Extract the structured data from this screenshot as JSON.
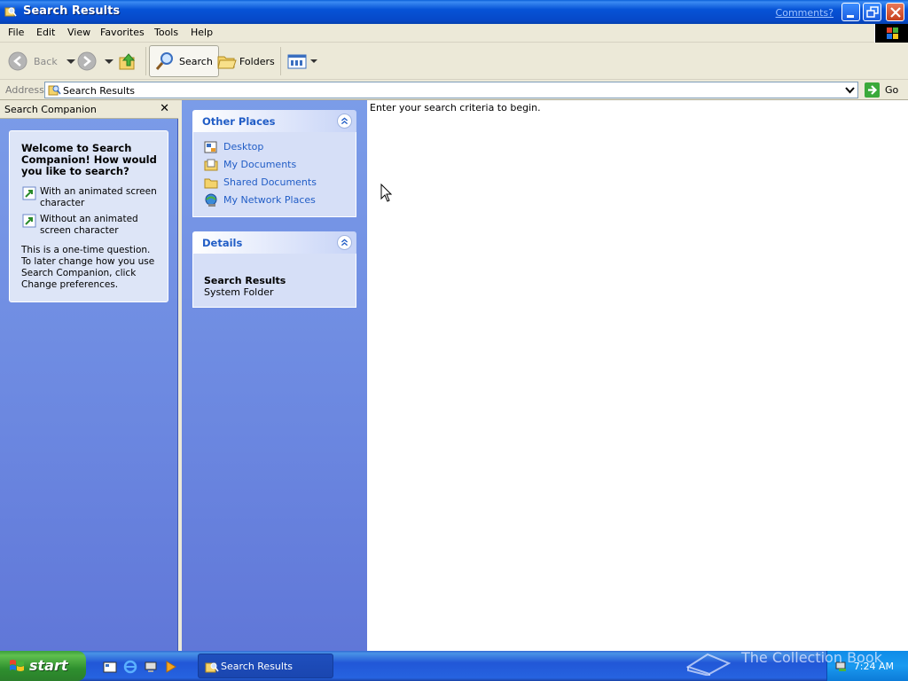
{
  "window": {
    "title": "Search Results",
    "comments_link": "Comments?"
  },
  "menu": [
    "File",
    "Edit",
    "View",
    "Favorites",
    "Tools",
    "Help"
  ],
  "toolbar": {
    "back_label": "Back",
    "search_label": "Search",
    "folders_label": "Folders"
  },
  "address": {
    "label": "Address",
    "value": "Search Results",
    "go_label": "Go"
  },
  "companion": {
    "title": "Search Companion",
    "welcome_title": "Welcome to Search Companion! How would you like to search?",
    "options": [
      "With an animated screen character",
      "Without an animated screen character"
    ],
    "note": "This is a one-time question. To later change how you use Search Companion, click Change preferences."
  },
  "tasks": {
    "other_places": {
      "title": "Other Places",
      "links": [
        "Desktop",
        "My Documents",
        "Shared Documents",
        "My Network Places"
      ]
    },
    "details": {
      "title": "Details",
      "name": "Search Results",
      "type": "System Folder"
    }
  },
  "results": {
    "message": "Enter your search criteria to begin."
  },
  "taskbar": {
    "start_label": "start",
    "task_label": "Search Results",
    "clock": "7:24 AM",
    "watermark": "The Collection Book"
  },
  "colors": {
    "title_bar": "#0653d6",
    "pane_blue": "#7b9ce8",
    "link_blue": "#215dc6",
    "start_green": "#3c9f3c"
  }
}
